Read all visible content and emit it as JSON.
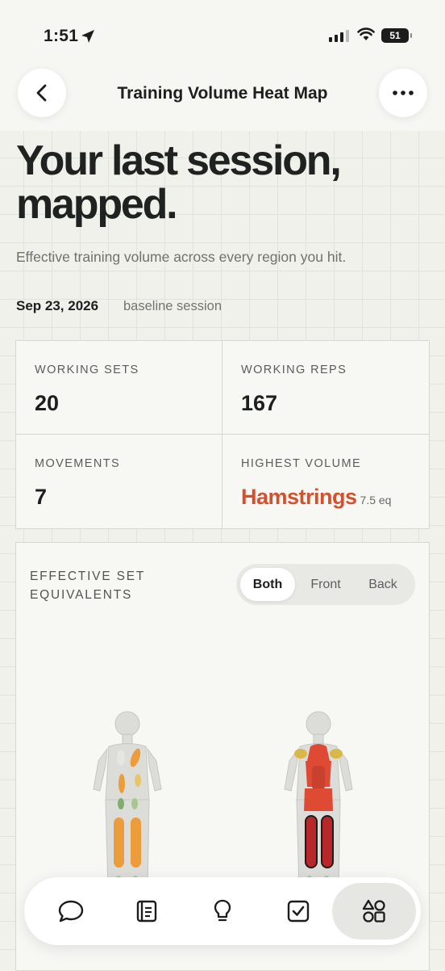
{
  "status_bar": {
    "time": "1:51",
    "battery": "51"
  },
  "nav": {
    "title": "Training Volume Heat Map"
  },
  "headline": "Your last session, mapped.",
  "subhead": "Effective training volume across every region you hit.",
  "session": {
    "date": "Sep 23, 2026",
    "note": "baseline session"
  },
  "stats": [
    {
      "label": "WORKING SETS",
      "value": "20"
    },
    {
      "label": "WORKING REPS",
      "value": "167"
    },
    {
      "label": "MOVEMENTS",
      "value": "7"
    },
    {
      "label": "HIGHEST VOLUME",
      "value": "Hamstrings",
      "unit": "7.5 eq"
    }
  ],
  "card": {
    "title": "EFFECTIVE SET EQUIVALENTS",
    "segments": [
      "Both",
      "Front",
      "Back"
    ],
    "active_segment": "Both"
  },
  "heat_colors": {
    "low": "#7fae6a",
    "moderate": "#d9b84a",
    "high": "#ed9c3c",
    "very_high": "#de4a33",
    "max": "#b8282a",
    "none": "#dcddd8"
  },
  "tabbar": {
    "items": [
      {
        "icon": "chat-bubble-icon"
      },
      {
        "icon": "journal-icon"
      },
      {
        "icon": "lightbulb-icon"
      },
      {
        "icon": "checkbox-icon"
      },
      {
        "icon": "shapes-icon",
        "active": true
      }
    ]
  },
  "colors": {
    "accent": "#d4512f",
    "background": "#f1f1ec"
  }
}
